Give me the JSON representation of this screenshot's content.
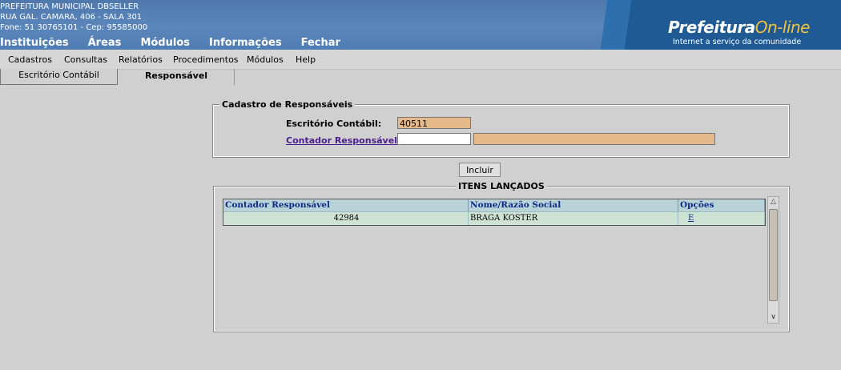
{
  "header": {
    "org_name": "PREFEITURA MUNICIPAL DBSELLER",
    "address": "RUA GAL. CAMARA, 406 - SALA 301",
    "phone": "Fone: 51 30765101  -  Cep: 95585000",
    "logo_main": "Prefeitura",
    "logo_online": "On-line",
    "logo_sub": "Internet a serviço da comunidade"
  },
  "top_nav": [
    "Instituições",
    "Áreas",
    "Módulos",
    "Informações",
    "Fechar"
  ],
  "menu": [
    "Cadastros",
    "Consultas",
    "Relatórios",
    "Procedimentos",
    "Módulos",
    "Help"
  ],
  "tabs": [
    {
      "label": "Escritório Contábil",
      "active": false
    },
    {
      "label": "Responsável",
      "active": true
    }
  ],
  "form": {
    "legend": "Cadastro de Responsáveis",
    "escritorio_label": "Escritório Contábil:",
    "escritorio_value": "40511",
    "contador_label": "Contador Responsável:",
    "contador_value": "",
    "contador_nome_value": ""
  },
  "include_button": "Incluir",
  "items": {
    "legend": "ITENS LANÇADOS",
    "columns": [
      "Contador Responsável",
      "Nome/Razão Social",
      "Opções"
    ],
    "rows": [
      {
        "contador": "42984",
        "nome": "BRAGA KOSTER",
        "opcao": "E"
      }
    ]
  },
  "colors": {
    "banner": "#5b86bb",
    "readonly_input": "#e6b98a",
    "grid_header": "#b9d3d9",
    "grid_row": "#cfe3d5"
  }
}
